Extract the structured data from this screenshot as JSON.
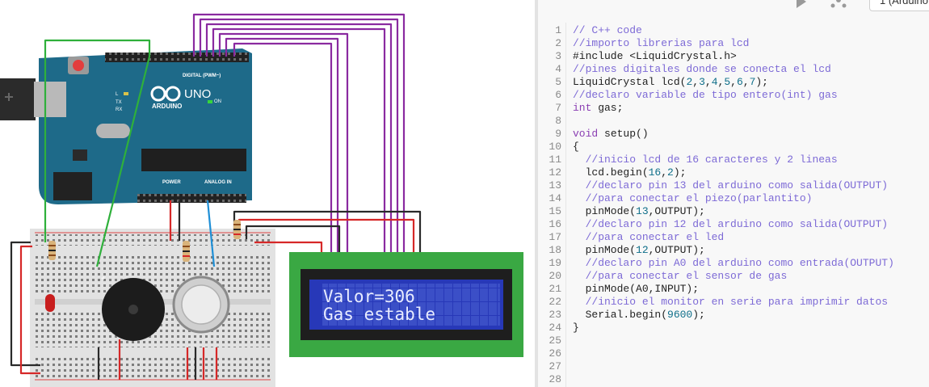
{
  "toolbar": {
    "device_label": "1 (Arduino"
  },
  "board": {
    "brand": "ARDUINO",
    "model": "UNO",
    "digital_label": "DIGITAL (PWM~)",
    "on_label": "ON",
    "power_label": "POWER",
    "analog_label": "ANALOG IN",
    "tx_label": "TX",
    "rx_label": "RX",
    "l_label": "L"
  },
  "lcd": {
    "line1": "Valor=306",
    "line2": "Gas estable"
  },
  "code": {
    "lines": [
      {
        "n": "1",
        "segs": [
          {
            "t": "// C++ code",
            "c": "cm"
          }
        ]
      },
      {
        "n": "2",
        "segs": [
          {
            "t": "//importo librerias para lcd",
            "c": "cm"
          }
        ]
      },
      {
        "n": "3",
        "segs": [
          {
            "t": "#include <LiquidCrystal.h>",
            "c": ""
          }
        ]
      },
      {
        "n": "4",
        "segs": [
          {
            "t": "//pines digitales donde se conecta el lcd",
            "c": "cm"
          }
        ]
      },
      {
        "n": "5",
        "segs": [
          {
            "t": "LiquidCrystal lcd(",
            "c": ""
          },
          {
            "t": "2",
            "c": "nm"
          },
          {
            "t": ",",
            "c": ""
          },
          {
            "t": "3",
            "c": "nm"
          },
          {
            "t": ",",
            "c": ""
          },
          {
            "t": "4",
            "c": "nm"
          },
          {
            "t": ",",
            "c": ""
          },
          {
            "t": "5",
            "c": "nm"
          },
          {
            "t": ",",
            "c": ""
          },
          {
            "t": "6",
            "c": "nm"
          },
          {
            "t": ",",
            "c": ""
          },
          {
            "t": "7",
            "c": "nm"
          },
          {
            "t": ");",
            "c": ""
          }
        ]
      },
      {
        "n": "6",
        "segs": [
          {
            "t": "//declaro variable de tipo entero(int) gas",
            "c": "cm"
          }
        ]
      },
      {
        "n": "7",
        "segs": [
          {
            "t": "int",
            "c": "kw"
          },
          {
            "t": " gas;",
            "c": ""
          }
        ]
      },
      {
        "n": "8",
        "segs": []
      },
      {
        "n": "9",
        "segs": [
          {
            "t": "void",
            "c": "kw"
          },
          {
            "t": " setup()",
            "c": ""
          }
        ]
      },
      {
        "n": "10",
        "segs": [
          {
            "t": "{",
            "c": ""
          }
        ]
      },
      {
        "n": "11",
        "segs": [
          {
            "t": "  //inicio lcd de 16 caracteres y 2 lineas",
            "c": "cm"
          }
        ]
      },
      {
        "n": "12",
        "segs": [
          {
            "t": "  lcd.begin(",
            "c": ""
          },
          {
            "t": "16",
            "c": "nm"
          },
          {
            "t": ",",
            "c": ""
          },
          {
            "t": "2",
            "c": "nm"
          },
          {
            "t": ");",
            "c": ""
          }
        ]
      },
      {
        "n": "13",
        "segs": [
          {
            "t": "  //declaro pin 13 del arduino como salida(OUTPUT)",
            "c": "cm"
          }
        ]
      },
      {
        "n": "14",
        "segs": [
          {
            "t": "  //para conectar el piezo(parlantito)",
            "c": "cm"
          }
        ]
      },
      {
        "n": "15",
        "segs": [
          {
            "t": "  pinMode(",
            "c": ""
          },
          {
            "t": "13",
            "c": "nm"
          },
          {
            "t": ",OUTPUT);",
            "c": ""
          }
        ]
      },
      {
        "n": "16",
        "segs": [
          {
            "t": "  //declaro pin 12 del arduino como salida(OUTPUT)",
            "c": "cm"
          }
        ]
      },
      {
        "n": "17",
        "segs": [
          {
            "t": "  //para conectar el led",
            "c": "cm"
          }
        ]
      },
      {
        "n": "18",
        "segs": [
          {
            "t": "  pinMode(",
            "c": ""
          },
          {
            "t": "12",
            "c": "nm"
          },
          {
            "t": ",OUTPUT);",
            "c": ""
          }
        ]
      },
      {
        "n": "19",
        "segs": [
          {
            "t": "  //declaro pin A0 del arduino como entrada(OUTPUT)",
            "c": "cm"
          }
        ]
      },
      {
        "n": "20",
        "segs": [
          {
            "t": "  //para conectar el sensor de gas",
            "c": "cm"
          }
        ]
      },
      {
        "n": "21",
        "segs": [
          {
            "t": "  pinMode(A0,INPUT);",
            "c": ""
          }
        ]
      },
      {
        "n": "22",
        "segs": [
          {
            "t": "  //inicio el monitor en serie para imprimir datos",
            "c": "cm"
          }
        ]
      },
      {
        "n": "23",
        "segs": [
          {
            "t": "  Serial.begin(",
            "c": ""
          },
          {
            "t": "9600",
            "c": "nm"
          },
          {
            "t": ");",
            "c": ""
          }
        ]
      },
      {
        "n": "24",
        "segs": [
          {
            "t": "}",
            "c": ""
          }
        ]
      },
      {
        "n": "25",
        "segs": []
      },
      {
        "n": "26",
        "segs": []
      },
      {
        "n": "27",
        "segs": []
      },
      {
        "n": "28",
        "segs": []
      }
    ]
  }
}
